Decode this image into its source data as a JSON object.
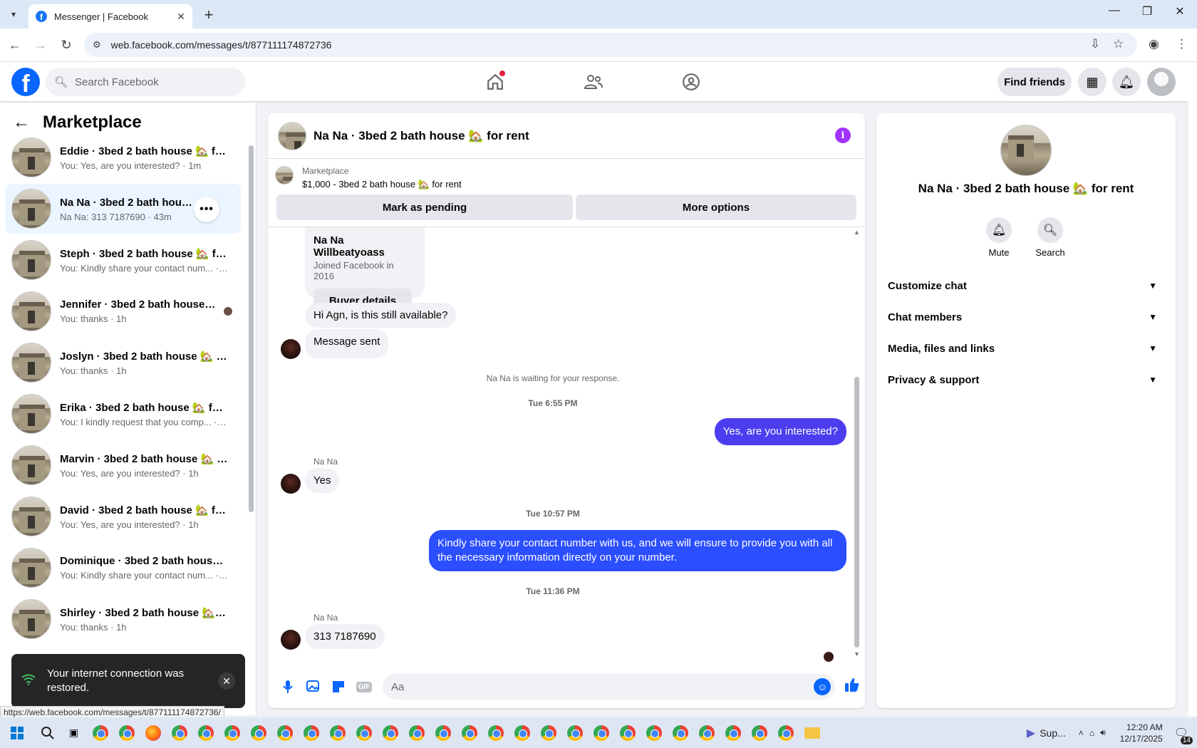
{
  "browser": {
    "tab_title": "Messenger | Facebook",
    "url": "web.facebook.com/messages/t/877111174872736",
    "status_url": "https://web.facebook.com/messages/t/877111174872736/"
  },
  "fb_header": {
    "search_placeholder": "Search Facebook",
    "find_friends": "Find friends"
  },
  "sidebar": {
    "title": "Marketplace",
    "conversations": [
      {
        "name": "Eddie · 3bed 2 bath house 🏡 fo...",
        "preview": "You: Yes, are you interested? · 1m"
      },
      {
        "name": "Na Na · 3bed 2 bath house 🏡 f...",
        "preview": "Na Na: 313 7187690 · 43m"
      },
      {
        "name": "Steph · 3bed 2 bath house 🏡 fo...",
        "preview": "You: Kindly share your contact num... · 1h"
      },
      {
        "name": "Jennifer · 3bed 2 bath house ...",
        "preview": "You: thanks · 1h"
      },
      {
        "name": "Joslyn · 3bed 2 bath house 🏡 fo...",
        "preview": "You: thanks · 1h"
      },
      {
        "name": "Erika · 3bed 2 bath house 🏡 for...",
        "preview": "You: I kindly request that you comp... · 1h"
      },
      {
        "name": "Marvin · 3bed 2 bath house 🏡 f...",
        "preview": "You: Yes, are you interested? · 1h"
      },
      {
        "name": "David · 3bed 2 bath house 🏡 fo...",
        "preview": "You: Yes, are you interested? · 1h"
      },
      {
        "name": "Dominique · 3bed 2 bath house ...",
        "preview": "You: Kindly share your contact num... · 1h"
      },
      {
        "name": "Shirley · 3bed 2 bath house 🏡 f...",
        "preview": "You: thanks · 1h"
      }
    ]
  },
  "toast": {
    "text": "Your internet connection was restored."
  },
  "chat": {
    "title": "Na Na · 3bed 2 bath house 🏡 for rent",
    "listing_label": "Marketplace",
    "listing_price": "$1,000 - 3bed 2 bath house 🏡 for rent",
    "mark_pending": "Mark as pending",
    "more_options": "More options",
    "buyer_name": "Na Na Willbeatyoass",
    "buyer_joined": "Joined Facebook in 2016",
    "buyer_details": "Buyer details",
    "msg_available": "Hi Agn, is this still available?",
    "msg_sent": "Message sent",
    "waiting": "Na Na is waiting for your response.",
    "ts1": "Tue 6:55 PM",
    "out1": "Yes, are you interested?",
    "sender_label": "Na Na",
    "in_yes": "Yes",
    "ts2": "Tue 10:57 PM",
    "out2": "Kindly share your contact number with us, and we will ensure to provide you with all the necessary information directly on your number.",
    "ts3": "Tue 11:36 PM",
    "in_phone": "313 7187690",
    "composer_placeholder": "Aa"
  },
  "right_panel": {
    "title": "Na Na · 3bed 2 bath house 🏡 for rent",
    "mute": "Mute",
    "search": "Search",
    "rows": [
      "Customize chat",
      "Chat members",
      "Media, files and links",
      "Privacy & support"
    ]
  },
  "taskbar": {
    "search_app": "Sup...",
    "time": "12:20 AM",
    "date": "12/17/2025",
    "notif_count": "14"
  }
}
